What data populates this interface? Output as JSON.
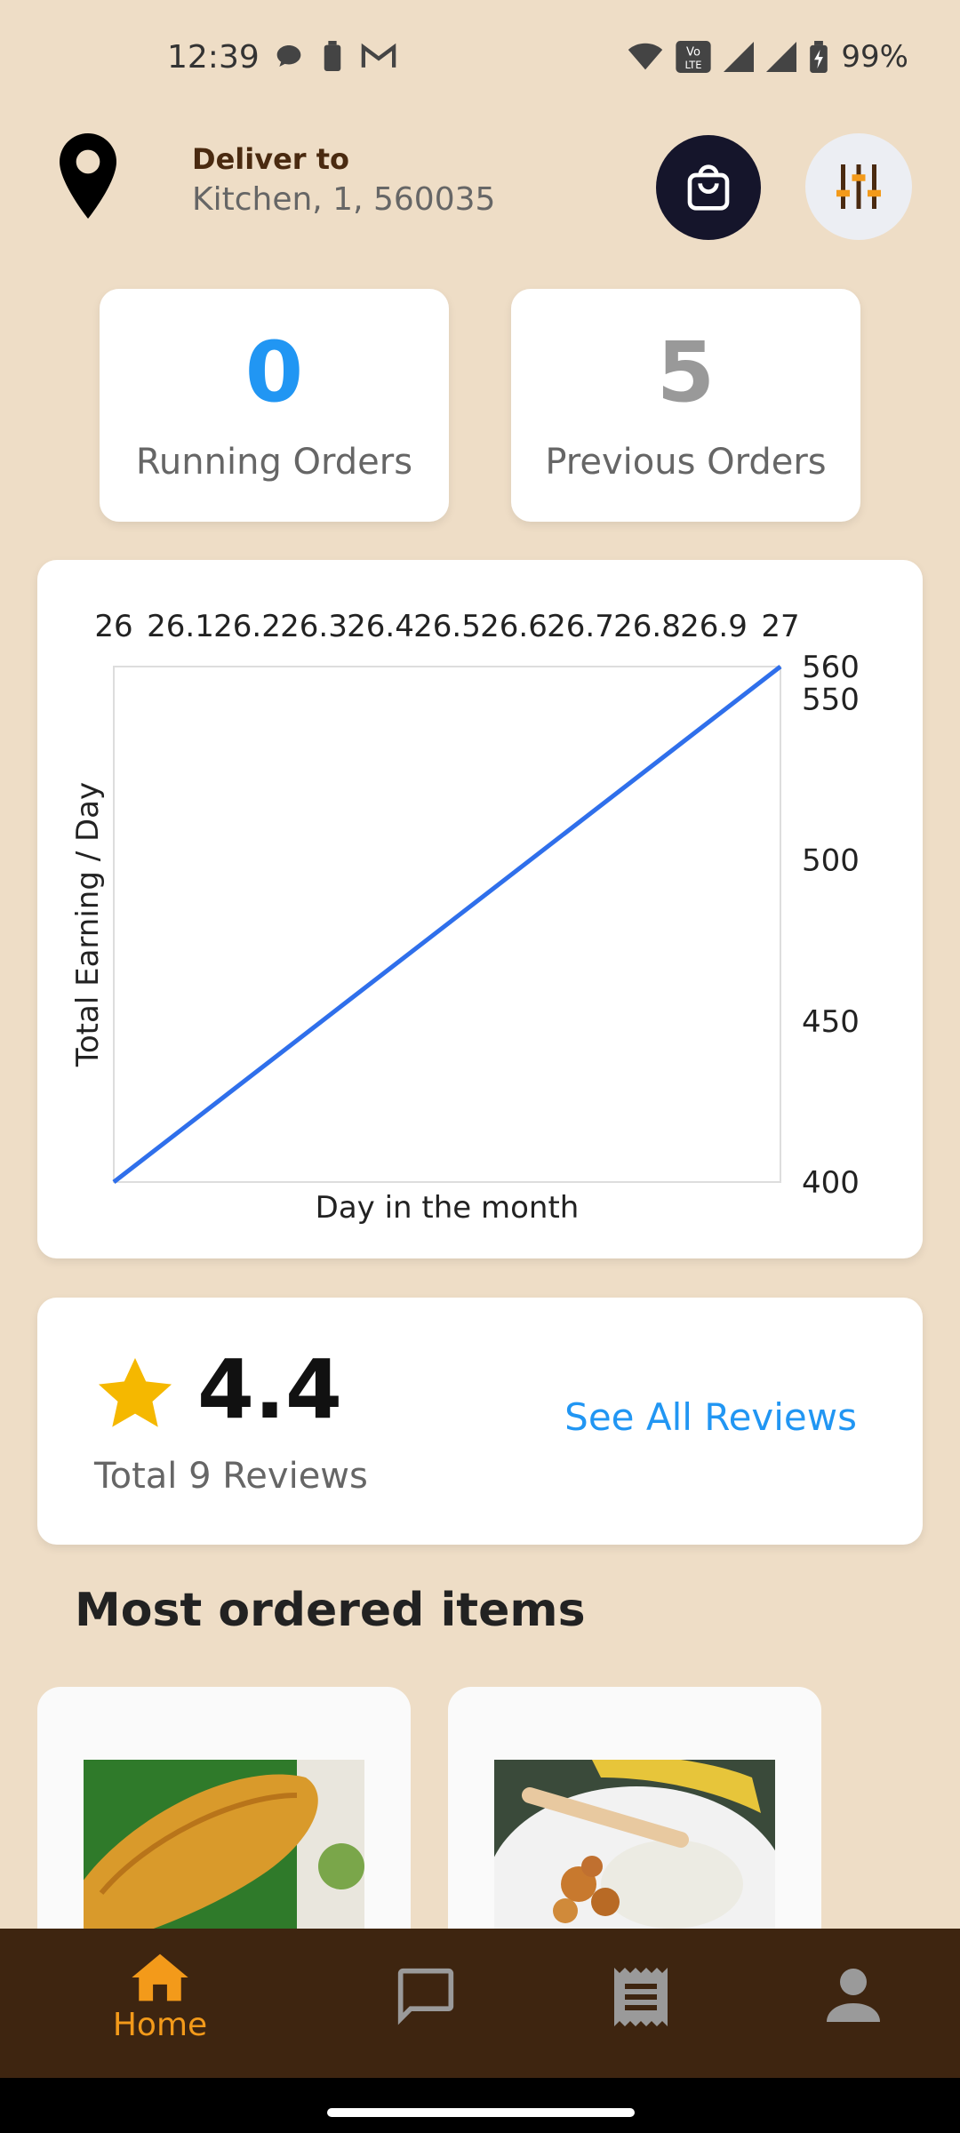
{
  "status_bar": {
    "time": "12:39",
    "battery": "99%",
    "icons_left": [
      "chat-bubble-icon",
      "battery-saver-icon",
      "gmail-icon"
    ],
    "icons_right": [
      "wifi-icon",
      "volte-icon",
      "signal-icon",
      "signal-icon",
      "battery-charging-icon"
    ]
  },
  "header": {
    "deliver_label": "Deliver to",
    "address": "Kitchen, 1, 560035",
    "cart_icon": "shopping-bag-icon",
    "filter_icon": "tune-icon"
  },
  "orders": {
    "running": {
      "count": "0",
      "label": "Running Orders",
      "color": "#2196F3"
    },
    "previous": {
      "count": "5",
      "label": "Previous Orders",
      "color": "#999999"
    }
  },
  "chart_data": {
    "type": "line",
    "xlabel": "Day in the month",
    "ylabel": "Total Earning / Day",
    "x_ticks": [
      "26",
      "26.1",
      "26.2",
      "26.3",
      "26.4",
      "26.5",
      "26.6",
      "26.7",
      "26.8",
      "26.9",
      "27"
    ],
    "y_ticks": [
      "560",
      "550",
      "500",
      "450",
      "400"
    ],
    "xlim": [
      26,
      27
    ],
    "ylim": [
      400,
      560
    ],
    "series": [
      {
        "x": [
          26,
          27
        ],
        "y": [
          400,
          560
        ],
        "color": "#2F6FEB"
      }
    ]
  },
  "reviews": {
    "rating": "4.4",
    "total": "Total 9 Reviews",
    "see_all": "See All Reviews",
    "star_color": "#F5B800"
  },
  "most_ordered": {
    "title": "Most ordered items",
    "items": [
      {
        "image": "dosa-image"
      },
      {
        "image": "fried-rice-plate-image"
      }
    ]
  },
  "bottom_nav": {
    "items": [
      {
        "icon": "home-icon",
        "label": "Home",
        "active": true
      },
      {
        "icon": "chat-icon",
        "label": ""
      },
      {
        "icon": "receipt-icon",
        "label": ""
      },
      {
        "icon": "person-icon",
        "label": ""
      }
    ],
    "active_color": "#F39A1A"
  }
}
